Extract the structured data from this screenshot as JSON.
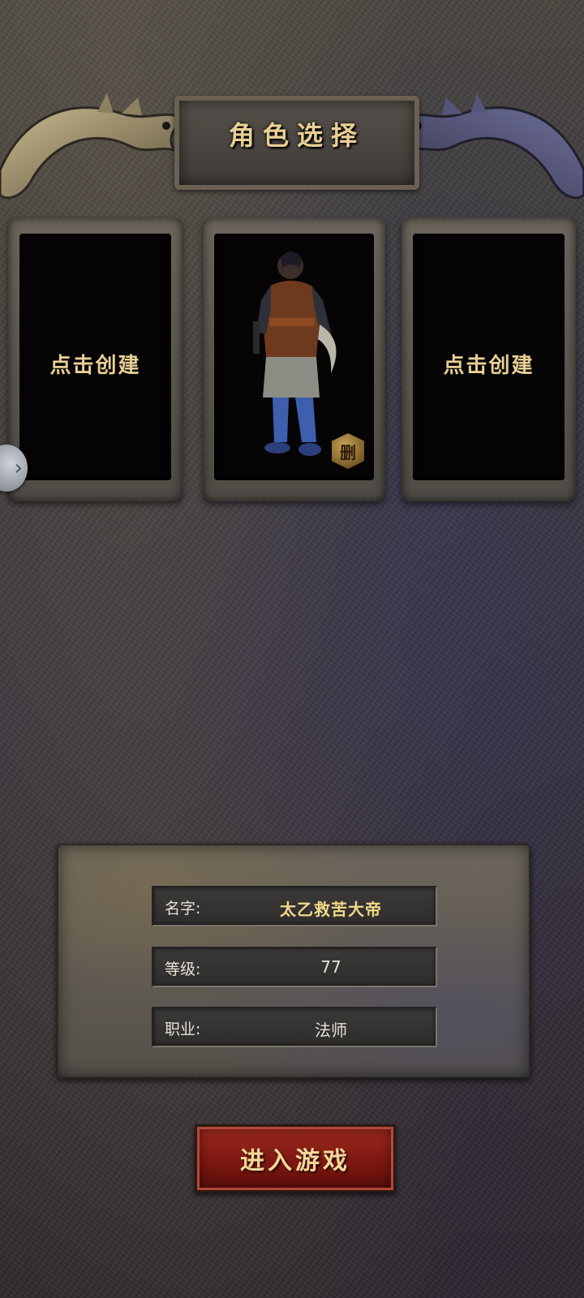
{
  "header": {
    "title": "角色选择"
  },
  "slots": [
    {
      "label": "点击创建"
    },
    {
      "label": ""
    },
    {
      "label": "点击创建"
    }
  ],
  "character_slot": {
    "delete_label": "删"
  },
  "info": {
    "name_label": "名字:",
    "name_value": "太乙救苦大帝",
    "level_label": "等级:",
    "level_value": "77",
    "class_label": "职业:",
    "class_value": "法师"
  },
  "enter_button": {
    "label": "进入游戏"
  },
  "colors": {
    "gold_text": "#e8cf94",
    "button_red": "#7a1710"
  }
}
